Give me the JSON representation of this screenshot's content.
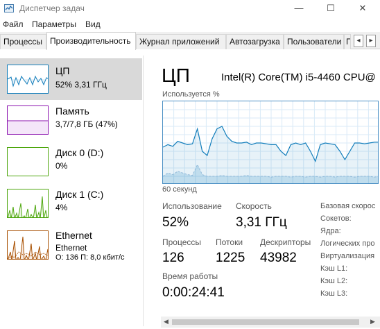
{
  "window": {
    "title": "Диспетчер задач",
    "minimize_glyph": "—",
    "maximize_glyph": "☐",
    "close_glyph": "✕"
  },
  "menu": [
    "Файл",
    "Параметры",
    "Вид"
  ],
  "tabs": [
    {
      "label": "Процессы",
      "active": false
    },
    {
      "label": "Производительность",
      "active": true
    },
    {
      "label": "Журнал приложений",
      "active": false
    },
    {
      "label": "Автозагрузка",
      "active": false
    },
    {
      "label": "Пользователи",
      "active": false
    },
    {
      "label": "Подробности",
      "active": false
    }
  ],
  "tab_scroll": {
    "left_glyph": "◂",
    "right_glyph": "▸"
  },
  "sidebar": {
    "items": [
      {
        "title": "ЦП",
        "subtitle": "52% 3,31 ГГц",
        "color": "#117dbb",
        "selected": true
      },
      {
        "title": "Память",
        "subtitle": "3,7/7,8 ГБ (47%)",
        "color": "#8b12ae",
        "selected": false
      },
      {
        "title": "Диск 0 (D:)",
        "subtitle": "0%",
        "color": "#4da60c",
        "selected": false
      },
      {
        "title": "Диск 1 (C:)",
        "subtitle": "4%",
        "color": "#4da60c",
        "selected": false
      },
      {
        "title": "Ethernet",
        "subtitle": "Ethernet",
        "subtitle2": "О: 136 П: 8,0 кбит/с",
        "color": "#a74f01",
        "selected": false
      }
    ]
  },
  "main": {
    "title": "ЦП",
    "cpu_model": "Intel(R) Core(TM) i5-4460 CPU@",
    "graph_label": "Используется %",
    "graph_time": "60 секунд",
    "stats": {
      "usage_label": "Использование",
      "usage_value": "52%",
      "speed_label": "Скорость",
      "speed_value": "3,31 ГГц",
      "processes_label": "Процессы",
      "processes_value": "126",
      "threads_label": "Потоки",
      "threads_value": "1225",
      "handles_label": "Дескрипторы",
      "handles_value": "43982",
      "uptime_label": "Время работы",
      "uptime_value": "0:00:24:41"
    },
    "specs": [
      "Базовая скорос",
      "Сокетов:",
      "Ядра:",
      "Логических про",
      "Виртуализация",
      "Кэш L1:",
      "Кэш L2:",
      "Кэш L3:"
    ]
  },
  "chart_data": {
    "type": "line",
    "title": "Используется %",
    "xlabel": "60 секунд",
    "ylim": [
      0,
      100
    ],
    "series": [
      {
        "values": [
          45,
          48,
          46,
          52,
          50,
          48,
          49,
          67,
          40,
          35,
          55,
          67,
          70,
          58,
          52,
          50,
          50,
          51,
          48,
          50,
          50,
          49,
          48,
          48,
          40,
          35,
          48,
          50,
          48,
          50,
          40,
          28,
          48,
          50,
          49,
          48,
          40,
          30,
          40,
          50,
          50,
          49,
          50,
          51,
          51
        ]
      },
      {
        "values": [
          10,
          14,
          12,
          16,
          14,
          12,
          11,
          24,
          12,
          10,
          10,
          10,
          11,
          10,
          10,
          10,
          10,
          11,
          10,
          10,
          10,
          10,
          9,
          10,
          10,
          10,
          9,
          10,
          10,
          9,
          10,
          10,
          9,
          10,
          10,
          9,
          10,
          10,
          10,
          9,
          10,
          10,
          10,
          9,
          10
        ]
      }
    ]
  }
}
